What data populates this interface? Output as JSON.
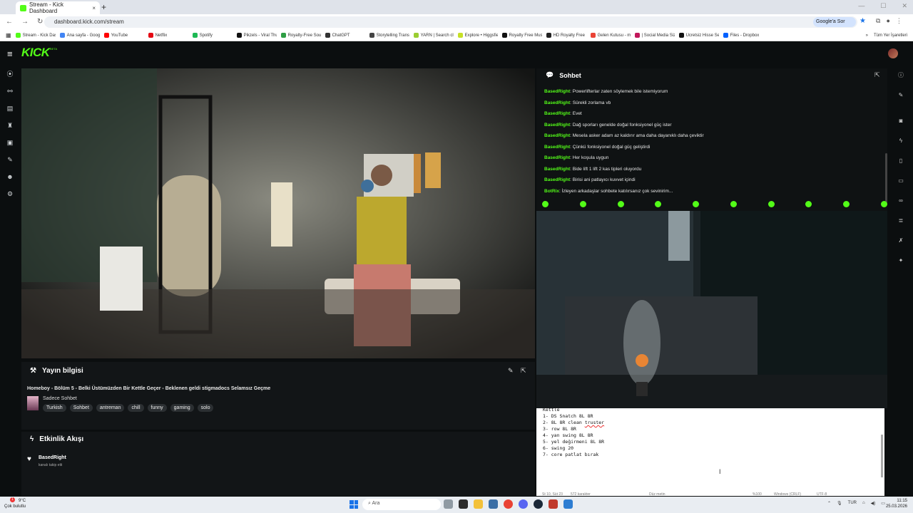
{
  "browser": {
    "tab_title": "Stream - Kick Dashboard",
    "tab_close": "×",
    "new_tab": "+",
    "url": "dashboard.kick.com/stream",
    "google_button": "Google'a Sor",
    "other_bookmarks": "Tüm Yer İşaretleri",
    "bookmarks": [
      {
        "label": "Stream - Kick Dashb...",
        "color": "#53fc18"
      },
      {
        "label": "Ana sayfa - Google...",
        "color": "#4285f4"
      },
      {
        "label": "YouTube",
        "color": "#ff0000"
      },
      {
        "label": "Netflix",
        "color": "#e50914"
      },
      {
        "label": "Spotify",
        "color": "#1db954"
      },
      {
        "label": "Pikzels - Viral Thum...",
        "color": "#111111"
      },
      {
        "label": "Royalty-Free Sound...",
        "color": "#2f9e44"
      },
      {
        "label": "ChatGPT",
        "color": "#333333"
      },
      {
        "label": "Storytelling Transfor...",
        "color": "#444444"
      },
      {
        "label": "YARN | Search clips...",
        "color": "#9acd32"
      },
      {
        "label": "Explore • Higgsfield",
        "color": "#c6e026"
      },
      {
        "label": "Royalty Free Music f...",
        "color": "#111111"
      },
      {
        "label": "HD Royalty Free Sto...",
        "color": "#222222"
      },
      {
        "label": "Gelen Kutusu - mert...",
        "color": "#ea4335"
      },
      {
        "label": "| Social Media Sizes...",
        "color": "#c2185b"
      },
      {
        "label": "Ücretsiz Hisse Sene...",
        "color": "#111111"
      },
      {
        "label": "Files - Dropbox",
        "color": "#0061ff"
      }
    ]
  },
  "kick": {
    "logo": "KICK",
    "beta": "BETA",
    "menu_icon": "≡"
  },
  "stream_info": {
    "header": "Yayın bilgisi",
    "title": "Homeboy - Bölüm 5 - Belki Üstümüzden Bir Kettle Geçer - Beklenen geldi stigmadocs Selamsız Geçme",
    "category": "Sadece Sohbet",
    "tags": [
      "Turkish",
      "Sohbet",
      "antreman",
      "chill",
      "funny",
      "gaming",
      "solo"
    ]
  },
  "activity": {
    "header": "Etkinlik Akışı",
    "user": "BasedRight",
    "text": "kanalı takip etti"
  },
  "chat": {
    "header": "Sohbet",
    "messages": [
      {
        "user": "BasedRight",
        "text": ": Powerlifterlar zaten söylemek bile istemiyorum"
      },
      {
        "user": "BasedRight",
        "text": ": Sürekli zorlama vb"
      },
      {
        "user": "BasedRight",
        "text": ": Evet"
      },
      {
        "user": "BasedRight",
        "text": ": Dağ sporları genelde doğal fonksiyonel güç ister"
      },
      {
        "user": "BasedRight",
        "text": ": Mesela asker adam az kaldırır ama daha dayanıklı daha çeviktir"
      },
      {
        "user": "BasedRight",
        "text": ": Çünkü fonksiyonel doğal güç geliştirdi"
      },
      {
        "user": "BasedRight",
        "text": ": Her koşula uygun"
      },
      {
        "user": "BasedRight",
        "text": ": Bide lift 1 lift 2 kas tipleri oluyordu"
      },
      {
        "user": "BasedRight",
        "text": ": Birisi ani patlayıcı kuvvet içindi"
      },
      {
        "user": "BotRix",
        "text": ": İzleyen arkadaşlar sohbete katılırsanız çok sevinirim..."
      }
    ]
  },
  "notepad": {
    "lines": [
      "Kettle",
      "1- DS Snatch 8L 8R",
      "2- 8L 8R clean truster",
      "3- row 8L 8R",
      "4- yan swing 8L 8R",
      "5- yel değirmeni 8L 8R",
      "6- swing 20",
      "7- core patlat bırak"
    ],
    "status_pos": "St 10, Süt 23",
    "status_chars": "572 karakter",
    "status_format": "Düz metin",
    "status_zoom": "%100",
    "status_eol": "Windows (CRLF)",
    "status_enc": "UTF-8"
  },
  "taskbar": {
    "weather_temp": "9°C",
    "weather_desc": "Çok bulutlu",
    "weather_badge": "1",
    "search": "Ara",
    "lang": "TUR",
    "time": "11:15",
    "date": "25.03.2026"
  },
  "colors": {
    "kick_green": "#53fc18",
    "panel": "#121517",
    "background": "#0b0e0f"
  }
}
